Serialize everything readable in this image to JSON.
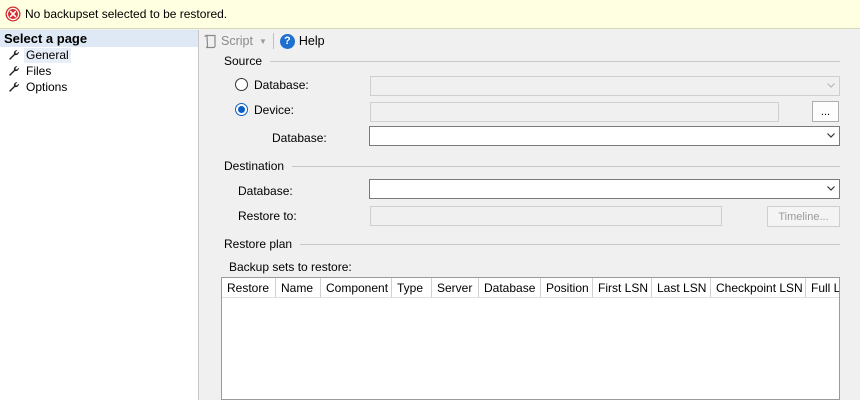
{
  "error_bar": {
    "message": "No backupset selected to be restored."
  },
  "sidebar": {
    "title": "Select a page",
    "items": [
      {
        "label": "General",
        "selected": true
      },
      {
        "label": "Files",
        "selected": false
      },
      {
        "label": "Options",
        "selected": false
      }
    ]
  },
  "toolbar": {
    "script_label": "Script",
    "help_label": "Help"
  },
  "source": {
    "title": "Source",
    "database_radio_label": "Database:",
    "device_radio_label": "Device:",
    "device_database_label": "Database:",
    "browse_label": "...",
    "selected": "device"
  },
  "destination": {
    "title": "Destination",
    "database_label": "Database:",
    "restore_to_label": "Restore to:",
    "timeline_label": "Timeline..."
  },
  "restore_plan": {
    "title": "Restore plan",
    "backup_sets_label": "Backup sets to restore:",
    "columns": [
      "Restore",
      "Name",
      "Component",
      "Type",
      "Server",
      "Database",
      "Position",
      "First LSN",
      "Last LSN",
      "Checkpoint LSN",
      "Full LSN"
    ]
  },
  "colors": {
    "accent": "#0a5fc7",
    "error_bg": "#ffffe1",
    "error_icon": "#d62b2b",
    "help_icon": "#1f6fd1"
  },
  "icons": {
    "error": "error-x-icon",
    "page": "wrench-icon",
    "script": "script-icon",
    "help": "help-icon",
    "dropdown": "chevron-down-icon"
  }
}
